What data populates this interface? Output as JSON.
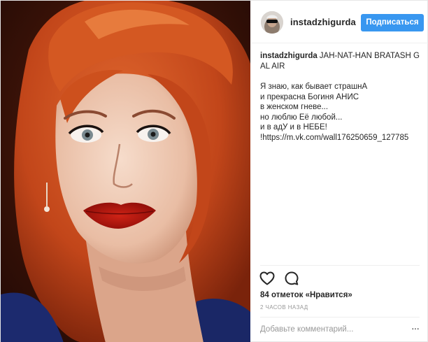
{
  "post": {
    "header": {
      "username": "instadzhigurda",
      "follow_label": "Подписаться",
      "avatar_icon": "profile-avatar"
    },
    "caption": {
      "username": "instadzhigurda",
      "title": "JAH-NAT-HAN BRATASH G AL AIR",
      "lines": [
        "Я знаю, как бывает страшнА",
        "и прекрасна Богиня АНИС",
        "в женском гневе...",
        "но люблю Её любой...",
        "и в адУ и в НЕБЕ!",
        "!https://m.vk.com/wall176250659_127785"
      ]
    },
    "actions": {
      "like_icon": "heart-icon",
      "comment_icon": "comment-icon"
    },
    "likes_text": "84 отметок «Нравится»",
    "timestamp": "2 ЧАСОВ НАЗАД",
    "comment": {
      "placeholder": "Добавьте комментарий...",
      "more_label": "···"
    },
    "colors": {
      "follow_button": "#3897f0",
      "hair": "#c2461a",
      "lips": "#b2120c"
    }
  }
}
